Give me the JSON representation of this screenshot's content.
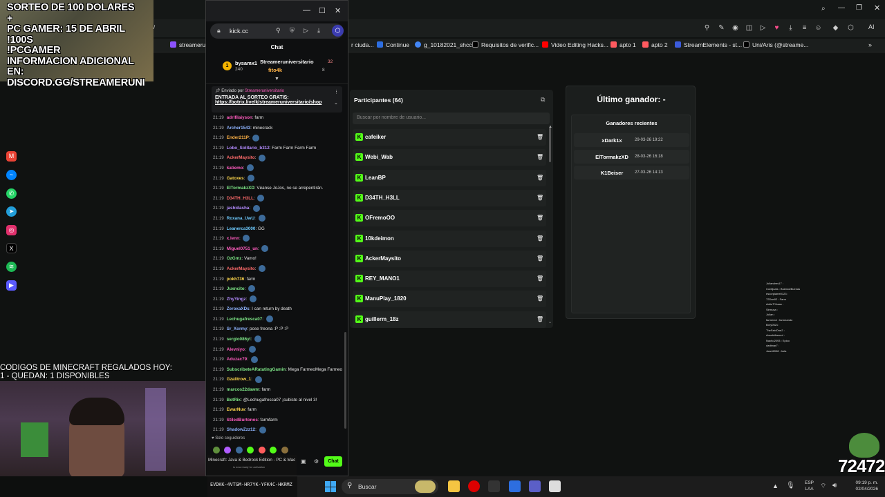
{
  "overlay": {
    "lines": [
      "SORTEO DE 100 DOLARES",
      "+",
      "PC GAMER: 15 DE ABRIL",
      "!100S",
      "!PCGAMER",
      "INFORMACION ADICIONAL EN:",
      "DISCORD.GG/STREAMERUNI"
    ],
    "codes_line1": "CODIGOS DE MINECRAFT REGALADOS HOY:",
    "codes_line2": "1 - QUEDAN: 1 DISPONIBLES"
  },
  "bookmarks": [
    {
      "label": "streameru",
      "color": "#8c52ff"
    },
    {
      "label": "r ciuda...",
      "color": "#555555"
    },
    {
      "label": "Continue",
      "color": "#2d6ee0"
    },
    {
      "label": "g_10182021_shcc",
      "color": "#4285f4"
    },
    {
      "label": "Requisitos de verific...",
      "color": "#000000"
    },
    {
      "label": "Video Editing Hacks...",
      "color": "#ff0000"
    },
    {
      "label": "apto 1",
      "color": "#ff5a5f"
    },
    {
      "label": "apto 2",
      "color": "#ff5a5f"
    },
    {
      "label": "StreamElements - st...",
      "color": "#3b5bdb"
    },
    {
      "label": "Uni/Aris (@streame...",
      "color": "#000000"
    }
  ],
  "browser": {
    "ai_label": "AI"
  },
  "chat_window": {
    "url": "kick.cc",
    "title": "Chat",
    "leaderboard": [
      {
        "rank": "1",
        "name": "bysamx1",
        "points": "240"
      },
      {
        "name": "Streameruniversitario",
        "count": "32"
      },
      {
        "name": "fito4k",
        "count": "8"
      }
    ],
    "pinned": {
      "header": "Enviado por",
      "sender": "Streameruniversitario",
      "text": "ENTRADA AL SORTEO GRATIS:",
      "link": "https://botrix.live/k/streameruniversitario/shop"
    },
    "messages": [
      {
        "time": "21:19",
        "user": "adrifilaiyson",
        "text": "farm",
        "color": "#ff5cbf"
      },
      {
        "time": "21:19",
        "user": "Archer1543",
        "text": "minecrack",
        "color": "#8fb4ff"
      },
      {
        "time": "21:19",
        "user": "Ender211P",
        "text": "",
        "color": "#ffb347",
        "emote": true
      },
      {
        "time": "21:19",
        "user": "Lobo_Solitario_b312",
        "text": "Farm Farm Farm Farm",
        "color": "#b48cff"
      },
      {
        "time": "21:19",
        "user": "AckerMaysito",
        "text": "",
        "color": "#ff6b6b",
        "emote": true
      },
      {
        "time": "21:19",
        "user": "katiemo",
        "text": "",
        "color": "#ff5cbf",
        "emote": true
      },
      {
        "time": "21:19",
        "user": "Gatoxes",
        "text": "",
        "color": "#ffd84d",
        "emote": true
      },
      {
        "time": "21:19",
        "user": "ElTormakzXD",
        "text": "Véanse JoJos, no se arrepentirán.",
        "color": "#7ee787"
      },
      {
        "time": "21:19",
        "user": "D34TH_H3LL",
        "text": "",
        "color": "#ff6b6b",
        "emote": true
      },
      {
        "time": "21:19",
        "user": "jashidasha",
        "text": "",
        "color": "#b48cff",
        "emote": true
      },
      {
        "time": "21:19",
        "user": "Roxana_UwU",
        "text": "",
        "color": "#6ecbff",
        "emote": true
      },
      {
        "time": "21:19",
        "user": "Leanerca3000",
        "text": "GG",
        "color": "#6ecbff"
      },
      {
        "time": "21:19",
        "user": "x.lenn",
        "text": "",
        "color": "#ff5cbf",
        "emote": true
      },
      {
        "time": "21:19",
        "user": "Miguel0751_un",
        "text": "",
        "color": "#ff5cbf",
        "emote": true
      },
      {
        "time": "21:19",
        "user": "OzGmz",
        "text": "Vamo!",
        "color": "#7ee787"
      },
      {
        "time": "21:19",
        "user": "AckerMaysito",
        "text": "",
        "color": "#ff6b6b",
        "emote": true
      },
      {
        "time": "21:19",
        "user": "pokh736",
        "text": "farm",
        "color": "#ffd84d"
      },
      {
        "time": "21:19",
        "user": "Juxncito",
        "text": "",
        "color": "#7ee787",
        "emote": true
      },
      {
        "time": "21:19",
        "user": "ZhyYingz",
        "text": "",
        "color": "#b48cff",
        "emote": true
      },
      {
        "time": "21:19",
        "user": "ZeroxaXDs",
        "text": "I can return by death",
        "color": "#8fb4ff"
      },
      {
        "time": "21:19",
        "user": "Lechugafresca07",
        "text": "",
        "color": "#7ee787",
        "emote": true
      },
      {
        "time": "21:19",
        "user": "Sr_Xormy",
        "text": "pose freona :P :P :P",
        "color": "#8fb4ff"
      },
      {
        "time": "21:19",
        "user": "sergio086yt",
        "text": "",
        "color": "#7ee787",
        "emote": true
      },
      {
        "time": "21:19",
        "user": "Alevniyo",
        "text": "",
        "color": "#ff5cbf",
        "emote": true
      },
      {
        "time": "21:19",
        "user": "Aduzac79",
        "text": "",
        "color": "#ff5cbf",
        "emote": true
      },
      {
        "time": "21:19",
        "user": "SubscribeteARatatingGamin",
        "text": "Mega FarmeoMega Farmeo",
        "color": "#7ee787"
      },
      {
        "time": "21:19",
        "user": "Gzalitrow_1",
        "text": "",
        "color": "#ffd84d",
        "emote": true
      },
      {
        "time": "21:19",
        "user": "marcos22dawm",
        "text": "farm",
        "color": "#7ee787"
      },
      {
        "time": "21:19",
        "user": "BotRix",
        "text": "@Lechugafresca07 ¡subiste al nivel 3!",
        "color": "#7ee787"
      },
      {
        "time": "21:19",
        "user": "EwarNuv",
        "text": "farm",
        "color": "#ffd84d"
      },
      {
        "time": "21:19",
        "user": "StiledBurtonos",
        "text": "farmfarm",
        "color": "#ff5cbf"
      },
      {
        "time": "21:19",
        "user": "ShadowZzz12",
        "text": "",
        "color": "#8fb4ff",
        "emote": true
      }
    ],
    "followers_only": "Solo seguidores",
    "send_label": "Chat"
  },
  "minecraft_banner": {
    "title": "Minecraft: Java & Bedrock Edition - PC & Mac",
    "sub": "is now ready for activation",
    "code": "EVDKK-4VTGM-HR7YK-YFK4C-HKRMZ"
  },
  "participants": {
    "title": "Participantes (64)",
    "search_placeholder": "Buscar por nombre de usuario...",
    "items": [
      "cafeiker",
      "Webi_Wab",
      "LeanBP",
      "D34TH_H3LL",
      "OFremoOO",
      "10kdeimon",
      "AckerMaysito",
      "REY_MANO1",
      "ManuPlay_1820",
      "guillerm_18z"
    ]
  },
  "winner": {
    "title": "Último ganador: -",
    "recent_title": "Ganadores recientes",
    "recent": [
      {
        "name": "xDark1x",
        "date": "29-03-26 19:22"
      },
      {
        "name": "ElTormakzXD",
        "date": "28-03-26 16:18"
      },
      {
        "name": "K1Beiser",
        "date": "27-03-26 14:13"
      }
    ]
  },
  "mini_chat": [
    "Juliandres17 :",
    "Contijuais : Buenas!Buenas",
    "escorpiame0123 : ",
    "72Dan02 : Farm",
    "AdrieTYkaax : ",
    "Sirmusa : ",
    "Julian : ",
    "farmerxd : farmeando",
    "Bory0521 : ",
    "TheFabiOne2 : ",
    "AnsokMarmol : ",
    "Nacho2093 : Epico",
    "dariimar7 : ",
    "Juani2008 : hola"
  ],
  "pepe_counter": "72472",
  "taskbar": {
    "search_label": "Buscar",
    "lang1": "ESP",
    "lang2": "LAA",
    "time": "09:19 p. m.",
    "date": "02/04/2026"
  }
}
